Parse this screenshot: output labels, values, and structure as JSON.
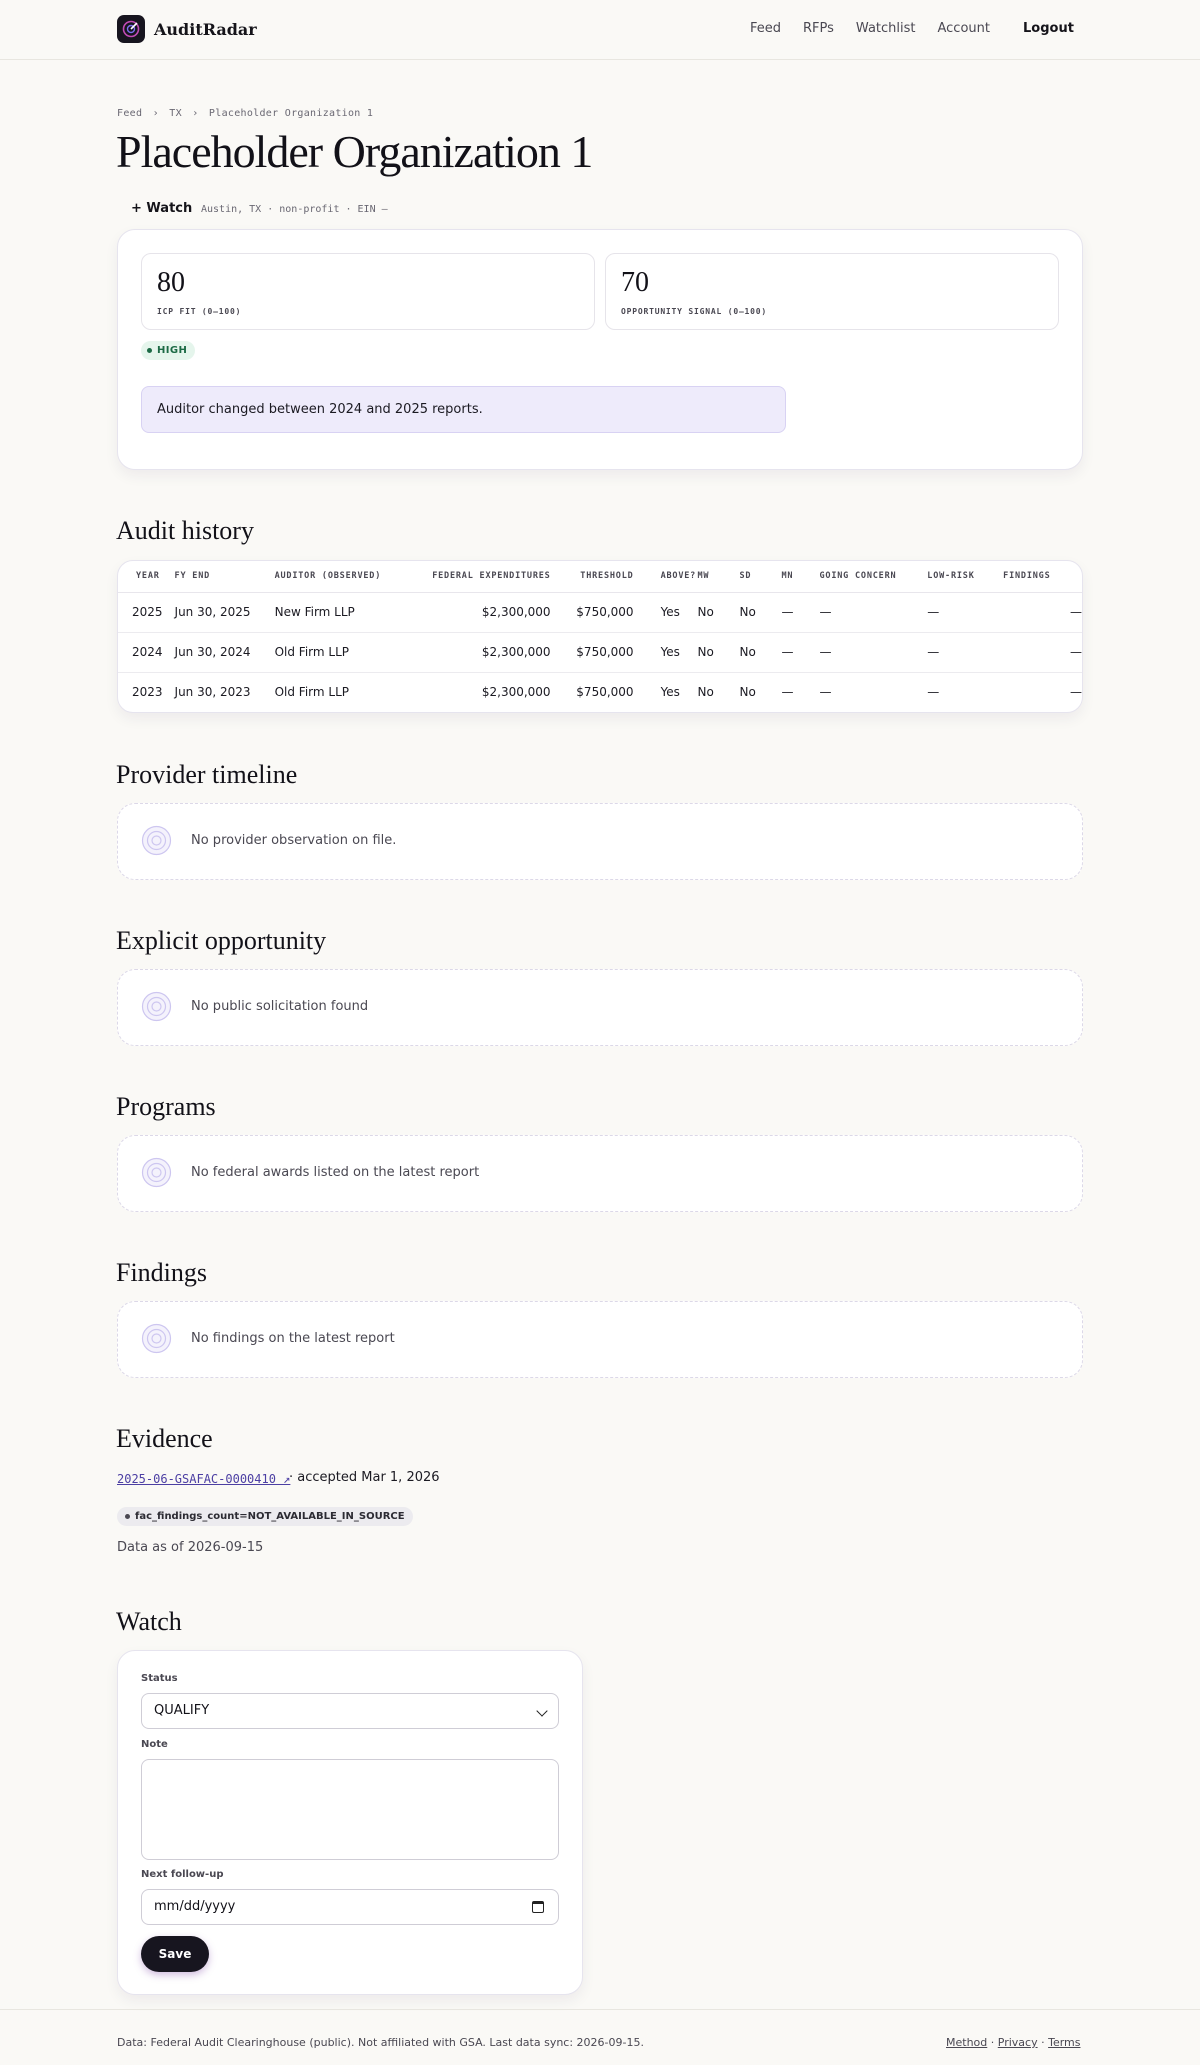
{
  "header": {
    "brand": "AuditRadar",
    "nav": [
      "Feed",
      "RFPs",
      "Watchlist",
      "Account"
    ],
    "logout": "Logout"
  },
  "breadcrumb": [
    "Feed",
    "TX",
    "Placeholder Organization 1"
  ],
  "breadcrumb_sep": "›",
  "title": "Placeholder Organization 1",
  "watch_button": "+ Watch",
  "meta": "Austin, TX · non-profit · EIN —",
  "scores": {
    "icp_value": "80",
    "icp_label": "ICP FIT (0–100)",
    "signal_value": "70",
    "signal_label": "OPPORTUNITY SIGNAL (0–100)",
    "badge": "HIGH",
    "badge_color": "#1c6a45",
    "alert": "Auditor changed between 2024 and 2025 reports."
  },
  "audit_history": {
    "title": "Audit history",
    "columns": [
      "YEAR",
      "FY END",
      "AUDITOR (OBSERVED)",
      "FEDERAL EXPENDITURES",
      "THRESHOLD",
      "ABOVE?",
      "MW",
      "SD",
      "MN",
      "GOING CONCERN",
      "LOW-RISK",
      "FINDINGS"
    ],
    "rows": [
      [
        "2025",
        "Jun 30, 2025",
        "New Firm LLP",
        "$2,300,000",
        "$750,000",
        "Yes",
        "No",
        "No",
        "—",
        "—",
        "—",
        "—"
      ],
      [
        "2024",
        "Jun 30, 2024",
        "Old Firm LLP",
        "$2,300,000",
        "$750,000",
        "Yes",
        "No",
        "No",
        "—",
        "—",
        "—",
        "—"
      ],
      [
        "2023",
        "Jun 30, 2023",
        "Old Firm LLP",
        "$2,300,000",
        "$750,000",
        "Yes",
        "No",
        "No",
        "—",
        "—",
        "—",
        "—"
      ]
    ]
  },
  "provider_timeline": {
    "title": "Provider timeline",
    "empty": "No provider observation on file."
  },
  "explicit_opportunity": {
    "title": "Explicit opportunity",
    "empty": "No public solicitation found"
  },
  "programs": {
    "title": "Programs",
    "empty": "No federal awards listed on the latest report"
  },
  "findings": {
    "title": "Findings",
    "empty": "No findings on the latest report"
  },
  "evidence": {
    "title": "Evidence",
    "link": "2025-06-GSAFAC-0000410 ↗",
    "accepted": "· accepted Mar 1, 2026",
    "chip": "fac_findings_count=NOT_AVAILABLE_IN_SOURCE",
    "as_of": "Data as of 2026-09-15"
  },
  "watch": {
    "title": "Watch",
    "status_label": "Status",
    "status_value": "QUALIFY",
    "note_label": "Note",
    "note_value": "",
    "followup_label": "Next follow-up",
    "followup_placeholder": "mm/dd/yyyy",
    "save": "Save"
  },
  "footer": {
    "text": "Data: Federal Audit Clearinghouse (public). Not affiliated with GSA. Last data sync: 2026-09-15.",
    "links": [
      "Method",
      "Privacy",
      "Terms"
    ],
    "sep": "·"
  },
  "colors": {
    "accent": "#4c3fa3",
    "dark": "#17151f",
    "alert_bg": "#eeebfb",
    "high_bg": "#e5f5ec"
  }
}
